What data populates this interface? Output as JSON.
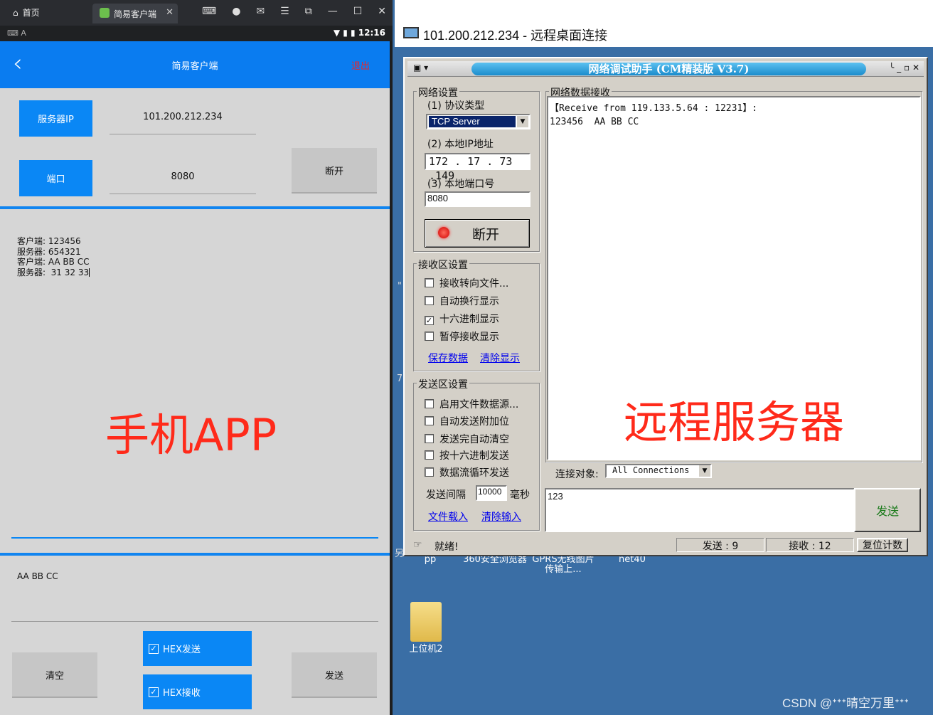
{
  "emulator": {
    "home_tab": "首页",
    "app_tab": "简易客户端",
    "tab_close": "✕",
    "clock": "12:16"
  },
  "app": {
    "title": "简易客户端",
    "back_icon": "chevron-left-icon",
    "exit_label": "退出",
    "server_ip_label": "服务器IP",
    "server_ip_value": "101.200.212.234",
    "port_label": "端口",
    "port_value": "8080",
    "disconnect_label": "断开",
    "log_lines": [
      "客户端: 123456",
      "服务器: 654321",
      "客户端: AA BB CC",
      "服务器:  31 32 33"
    ],
    "overlay_label": "手机APP",
    "send_input_value": "AA BB CC",
    "clear_label": "清空",
    "hex_send_label": "HEX发送",
    "hex_receive_label": "HEX接收",
    "send_label": "发送",
    "accent_color": "#0a87f5"
  },
  "rdp": {
    "window_title": "101.200.212.234 - 远程桌面连接",
    "tool": {
      "title": "网络调试助手 (CM精装版 V3.7)",
      "net_settings_label": "网络设置",
      "protocol_label": "(1) 协议类型",
      "protocol_value": "TCP Server",
      "local_ip_label": "(2) 本地IP地址",
      "local_ip_value": "172 . 17 . 73 .149",
      "local_port_label": "(3) 本地端口号",
      "local_port_value": "8080",
      "disconnect_label": "断开",
      "recv_settings_label": "接收区设置",
      "recv_options": [
        "接收转向文件...",
        "自动换行显示",
        "十六进制显示",
        "暂停接收显示"
      ],
      "recv_checked": [
        false,
        false,
        true,
        false
      ],
      "save_data_label": "保存数据",
      "clear_display_label": "清除显示",
      "send_settings_label": "发送区设置",
      "send_options": [
        "启用文件数据源...",
        "自动发送附加位",
        "发送完自动清空",
        "按十六进制发送",
        "数据流循环发送"
      ],
      "send_interval_label": "发送间隔",
      "send_interval_value": "10000",
      "send_interval_unit": "毫秒",
      "file_load_label": "文件载入",
      "clear_input_label": "清除输入",
      "recv_area_label": "网络数据接收",
      "recv_line1": "【Receive from 119.133.5.64 : 12231】:",
      "recv_line2": "123456  AA BB CC",
      "overlay_label": "远程服务器",
      "connect_target_label": "连接对象:",
      "connect_target_value": "All Connections",
      "send_text": "123",
      "send_button_label": "发送",
      "status_text": "就绪!",
      "sent_count": "发送 : 9",
      "recv_count": "接收 : 12",
      "reset_count_label": "复位计数"
    },
    "desktop_icons": [
      "pp",
      "360安全浏览器",
      "GPRS无线图片传输上...",
      "net40",
      "上位机2"
    ],
    "side_marks": [
      "另",
      "\"",
      "7"
    ],
    "watermark": "CSDN @ᐩᐩᐩ晴空万里ᐩᐩᐩ"
  }
}
